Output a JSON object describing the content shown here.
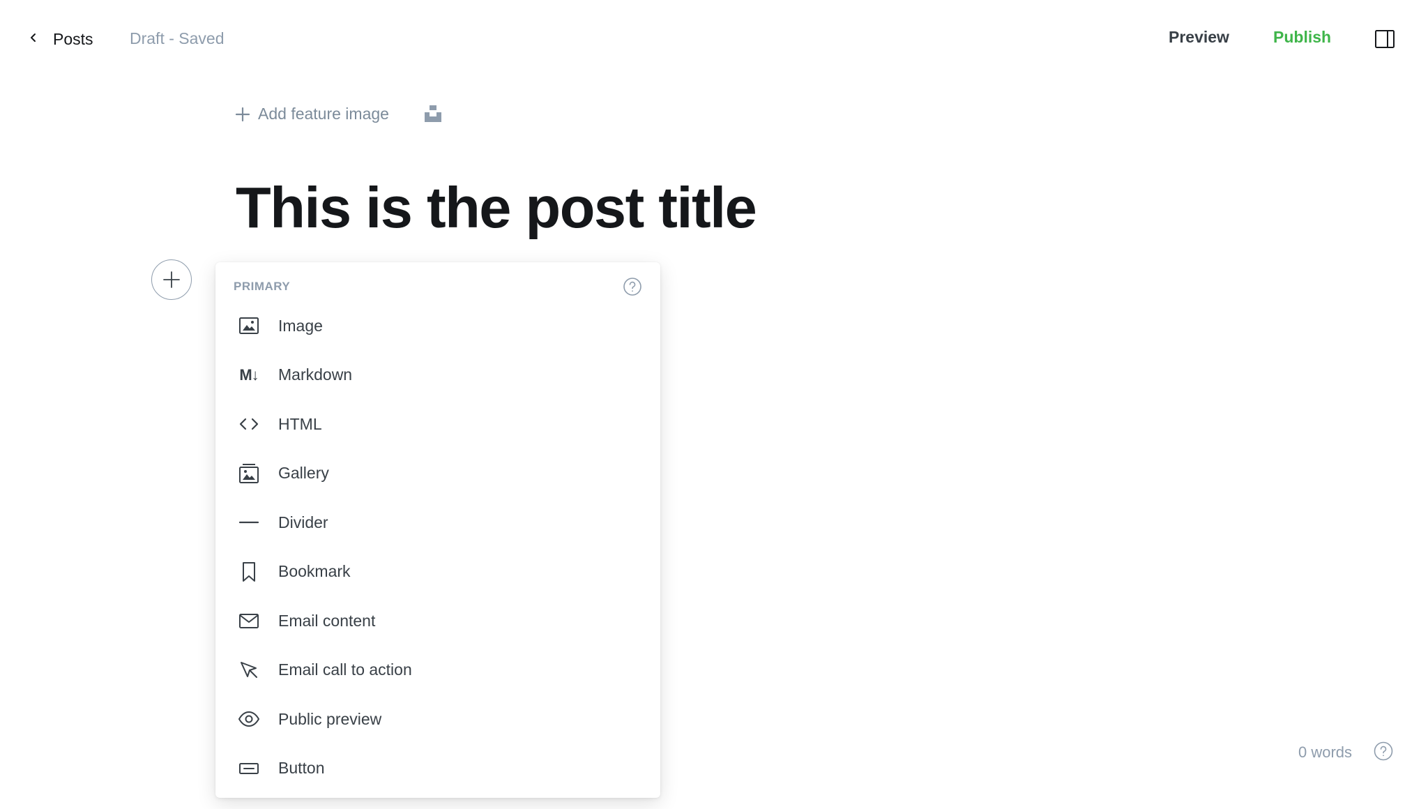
{
  "header": {
    "back_label": "Posts",
    "status": "Draft - Saved",
    "preview_label": "Preview",
    "publish_label": "Publish"
  },
  "feature_image": {
    "label": "Add feature image"
  },
  "post": {
    "title": "This is the post title"
  },
  "card_menu": {
    "section_label": "PRIMARY",
    "items": [
      {
        "label": "Image",
        "icon": "image-icon"
      },
      {
        "label": "Markdown",
        "icon": "markdown-icon",
        "icon_text": "M↓"
      },
      {
        "label": "HTML",
        "icon": "code-icon"
      },
      {
        "label": "Gallery",
        "icon": "gallery-icon"
      },
      {
        "label": "Divider",
        "icon": "divider-icon"
      },
      {
        "label": "Bookmark",
        "icon": "bookmark-icon"
      },
      {
        "label": "Email content",
        "icon": "envelope-icon"
      },
      {
        "label": "Email call to action",
        "icon": "cursor-icon"
      },
      {
        "label": "Public preview",
        "icon": "eye-icon"
      },
      {
        "label": "Button",
        "icon": "button-icon"
      }
    ]
  },
  "footer": {
    "word_count": "0 words"
  },
  "colors": {
    "publish": "#3fb54a",
    "muted": "#8e9cac",
    "text": "#15171a"
  }
}
